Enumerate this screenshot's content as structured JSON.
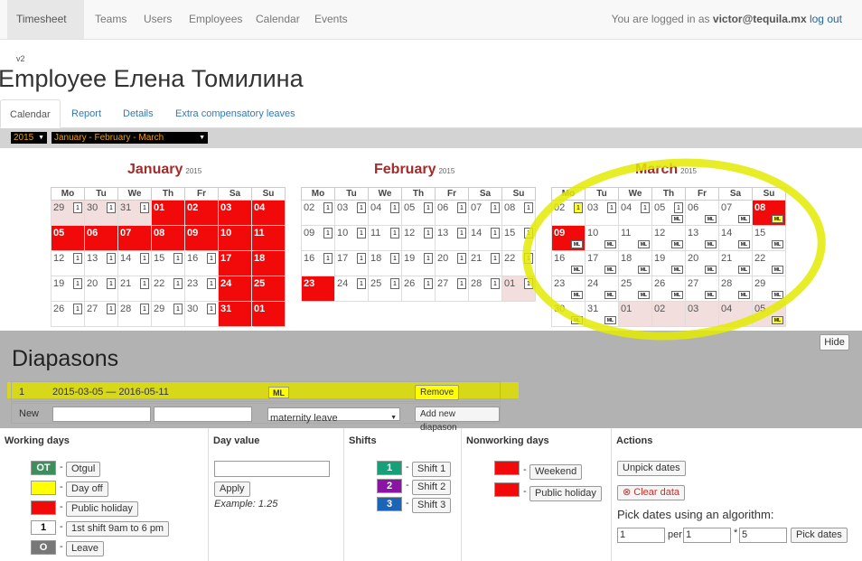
{
  "navbar": {
    "brand": "Timesheet",
    "brand_ver": "v2",
    "items": [
      "Teams",
      "Users",
      "Employees",
      "Calendar",
      "Events"
    ],
    "login_prefix": "You are logged in as",
    "user": "victor@tequila.mx",
    "logout": "log out"
  },
  "page": {
    "title": "Employee Елена Томилина"
  },
  "tabs": [
    "Calendar",
    "Report",
    "Details",
    "Extra compensatory leaves"
  ],
  "filters": {
    "year": "2015",
    "quarter": "January - February - March"
  },
  "calendar": {
    "weekdays": [
      "Mo",
      "Tu",
      "We",
      "Th",
      "Fr",
      "Sa",
      "Su"
    ],
    "year": "2015",
    "months": [
      {
        "name": "January",
        "weeks": [
          [
            {
              "d": "29",
              "t": "other",
              "b": "1"
            },
            {
              "d": "30",
              "t": "other",
              "b": "1"
            },
            {
              "d": "31",
              "t": "other",
              "b": "1"
            },
            {
              "d": "01",
              "t": "hol"
            },
            {
              "d": "02",
              "t": "hol"
            },
            {
              "d": "03",
              "t": "hol"
            },
            {
              "d": "04",
              "t": "hol"
            }
          ],
          [
            {
              "d": "05",
              "t": "hol"
            },
            {
              "d": "06",
              "t": "hol"
            },
            {
              "d": "07",
              "t": "hol"
            },
            {
              "d": "08",
              "t": "hol"
            },
            {
              "d": "09",
              "t": "hol"
            },
            {
              "d": "10",
              "t": "hol"
            },
            {
              "d": "11",
              "t": "hol"
            }
          ],
          [
            {
              "d": "12",
              "b": "1"
            },
            {
              "d": "13",
              "b": "1"
            },
            {
              "d": "14",
              "b": "1"
            },
            {
              "d": "15",
              "b": "1"
            },
            {
              "d": "16",
              "b": "1"
            },
            {
              "d": "17",
              "t": "hol"
            },
            {
              "d": "18",
              "t": "hol"
            }
          ],
          [
            {
              "d": "19",
              "b": "1"
            },
            {
              "d": "20",
              "b": "1"
            },
            {
              "d": "21",
              "b": "1"
            },
            {
              "d": "22",
              "b": "1"
            },
            {
              "d": "23",
              "b": "1"
            },
            {
              "d": "24",
              "t": "hol"
            },
            {
              "d": "25",
              "t": "hol"
            }
          ],
          [
            {
              "d": "26",
              "b": "1"
            },
            {
              "d": "27",
              "b": "1"
            },
            {
              "d": "28",
              "b": "1"
            },
            {
              "d": "29",
              "b": "1"
            },
            {
              "d": "30",
              "b": "1"
            },
            {
              "d": "31",
              "t": "hol"
            },
            {
              "d": "01",
              "t": "hol"
            }
          ]
        ]
      },
      {
        "name": "February",
        "weeks": [
          [
            {
              "d": "02",
              "b": "1"
            },
            {
              "d": "03",
              "b": "1"
            },
            {
              "d": "04",
              "b": "1"
            },
            {
              "d": "05",
              "b": "1"
            },
            {
              "d": "06",
              "b": "1"
            },
            {
              "d": "07",
              "b": "1"
            },
            {
              "d": "08",
              "b": "1"
            }
          ],
          [
            {
              "d": "09",
              "b": "1"
            },
            {
              "d": "10",
              "b": "1"
            },
            {
              "d": "11",
              "b": "1"
            },
            {
              "d": "12",
              "b": "1"
            },
            {
              "d": "13",
              "b": "1"
            },
            {
              "d": "14",
              "b": "1"
            },
            {
              "d": "15",
              "b": "1"
            }
          ],
          [
            {
              "d": "16",
              "b": "1"
            },
            {
              "d": "17",
              "b": "1"
            },
            {
              "d": "18",
              "b": "1"
            },
            {
              "d": "19",
              "b": "1"
            },
            {
              "d": "20",
              "b": "1"
            },
            {
              "d": "21",
              "b": "1"
            },
            {
              "d": "22",
              "b": "1"
            }
          ],
          [
            {
              "d": "23",
              "t": "hol"
            },
            {
              "d": "24",
              "b": "1"
            },
            {
              "d": "25",
              "b": "1"
            },
            {
              "d": "26",
              "b": "1"
            },
            {
              "d": "27",
              "b": "1"
            },
            {
              "d": "28",
              "b": "1"
            },
            {
              "d": "01",
              "t": "other",
              "b": "1"
            }
          ]
        ]
      },
      {
        "name": "March",
        "weeks": [
          [
            {
              "d": "02",
              "b": "1",
              "by": true
            },
            {
              "d": "03",
              "b": "1"
            },
            {
              "d": "04",
              "b": "1"
            },
            {
              "d": "05",
              "b": "1",
              "ml": "ML"
            },
            {
              "d": "06",
              "ml": "ML"
            },
            {
              "d": "07",
              "ml": "ML"
            },
            {
              "d": "08",
              "t": "hol",
              "ml": "ML",
              "mly": true
            }
          ],
          [
            {
              "d": "09",
              "t": "hol",
              "ml": "ML"
            },
            {
              "d": "10",
              "ml": "ML"
            },
            {
              "d": "11",
              "ml": "ML"
            },
            {
              "d": "12",
              "ml": "ML"
            },
            {
              "d": "13",
              "ml": "ML"
            },
            {
              "d": "14",
              "ml": "ML"
            },
            {
              "d": "15",
              "ml": "ML"
            }
          ],
          [
            {
              "d": "16",
              "ml": "ML"
            },
            {
              "d": "17",
              "ml": "ML"
            },
            {
              "d": "18",
              "ml": "ML"
            },
            {
              "d": "19",
              "ml": "ML"
            },
            {
              "d": "20",
              "ml": "ML"
            },
            {
              "d": "21",
              "ml": "ML"
            },
            {
              "d": "22",
              "ml": "ML"
            }
          ],
          [
            {
              "d": "23",
              "ml": "ML"
            },
            {
              "d": "24",
              "ml": "ML"
            },
            {
              "d": "25",
              "ml": "ML"
            },
            {
              "d": "26",
              "ml": "ML"
            },
            {
              "d": "27",
              "ml": "ML"
            },
            {
              "d": "28",
              "ml": "ML"
            },
            {
              "d": "29",
              "ml": "ML"
            }
          ],
          [
            {
              "d": "30",
              "ml": "ML"
            },
            {
              "d": "31",
              "ml": "ML"
            },
            {
              "d": "01",
              "t": "other"
            },
            {
              "d": "02",
              "t": "other"
            },
            {
              "d": "03",
              "t": "other"
            },
            {
              "d": "04",
              "t": "other"
            },
            {
              "d": "05",
              "t": "other",
              "ml": "ML",
              "mly": true
            }
          ]
        ]
      }
    ]
  },
  "diapasons": {
    "title": "Diapasons",
    "hide": "Hide",
    "row": {
      "num": "1",
      "range": "2015-03-05 — 2016-05-11",
      "tag": "ML",
      "remove": "Remove"
    },
    "new": {
      "label": "New",
      "type": "maternity leave",
      "add": "Add new diapason"
    }
  },
  "working_days": {
    "title": "Working days",
    "items": [
      {
        "sw": "OT",
        "label": "Otgul",
        "color": "#3c8f5a"
      },
      {
        "sw": "",
        "label": "Day off",
        "color": "#ffff00"
      },
      {
        "sw": "",
        "label": "Public holiday",
        "color": "#f20a0a"
      },
      {
        "sw": "1",
        "label": "1st shift 9am to 6 pm",
        "color": "#ffffff"
      },
      {
        "sw": "O",
        "label": "Leave",
        "color": "#777777"
      }
    ]
  },
  "day_value": {
    "title": "Day value",
    "apply": "Apply",
    "example": "Example: 1.25"
  },
  "shifts": {
    "title": "Shifts",
    "items": [
      {
        "sw": "1",
        "label": "Shift 1",
        "color": "#16a07a"
      },
      {
        "sw": "2",
        "label": "Shift 2",
        "color": "#8a15a5"
      },
      {
        "sw": "3",
        "label": "Shift 3",
        "color": "#1b64b8"
      }
    ]
  },
  "nonworking": {
    "title": "Nonworking days",
    "items": [
      {
        "label": "Weekend",
        "color": "#f20a0a"
      },
      {
        "label": "Public holiday",
        "color": "#f20a0a"
      }
    ]
  },
  "actions": {
    "title": "Actions",
    "unpick": "Unpick dates",
    "clear": "Clear data",
    "algo": "Pick dates using an algorithm:",
    "v1": "1",
    "per": "per",
    "v2": "1",
    "star": "*",
    "v3": "5",
    "pick": "Pick dates"
  }
}
